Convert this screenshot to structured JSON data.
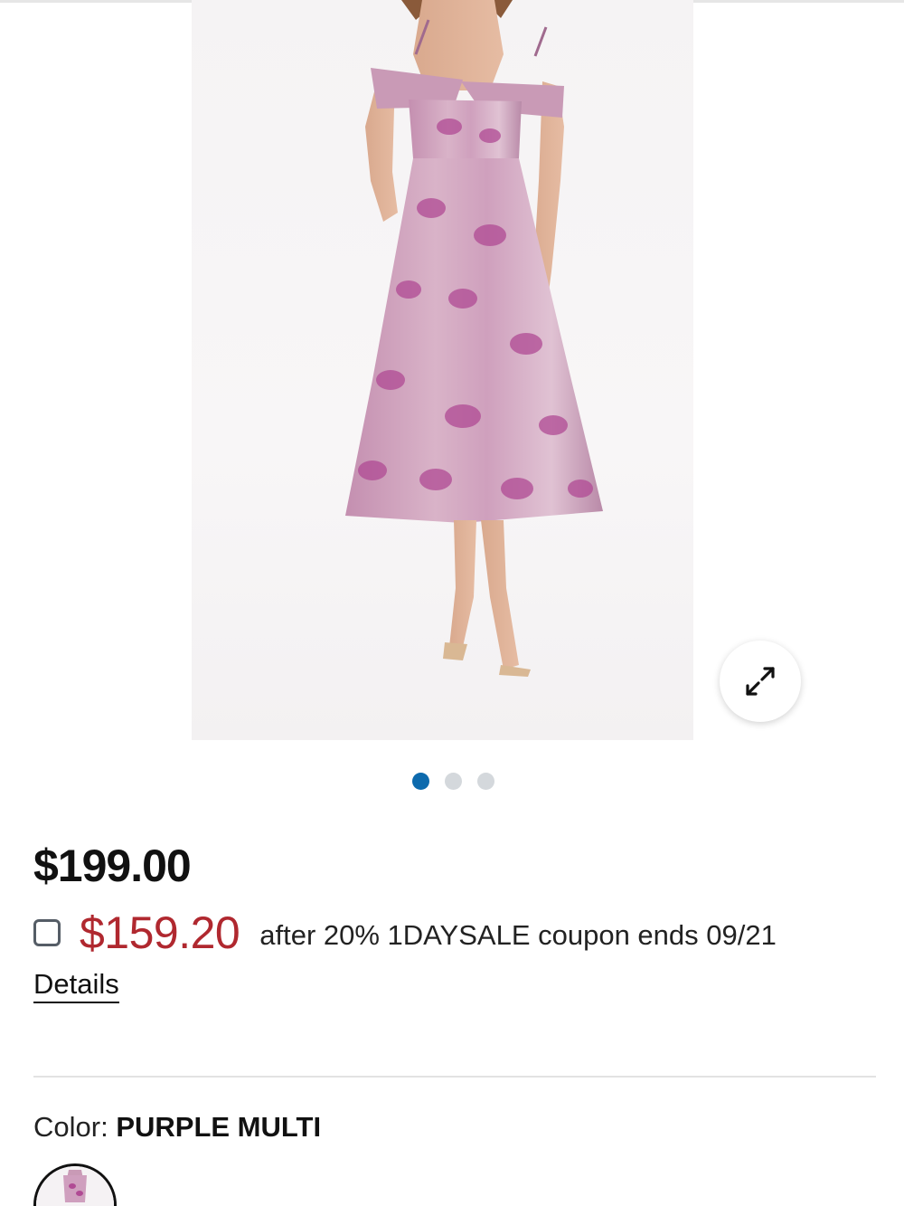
{
  "product": {
    "image_alt": "Woman wearing a purple floral jacquard off-the-shoulder midi dress",
    "carousel": {
      "total": 3,
      "active_index": 0
    },
    "prices": {
      "regular": "$199.00",
      "sale": "$159.20",
      "coupon_text": "after 20% 1DAYSALE coupon ends 09/21"
    },
    "details_link": "Details",
    "color": {
      "label": "Color: ",
      "value": "PURPLE MULTI"
    }
  },
  "icons": {
    "expand": "expand-arrows-icon",
    "checkbox": "checkbox-icon"
  },
  "colors": {
    "sale_price": "#b0282f",
    "active_dot": "#0d6aad",
    "inactive_dot": "#d4d8dc"
  }
}
